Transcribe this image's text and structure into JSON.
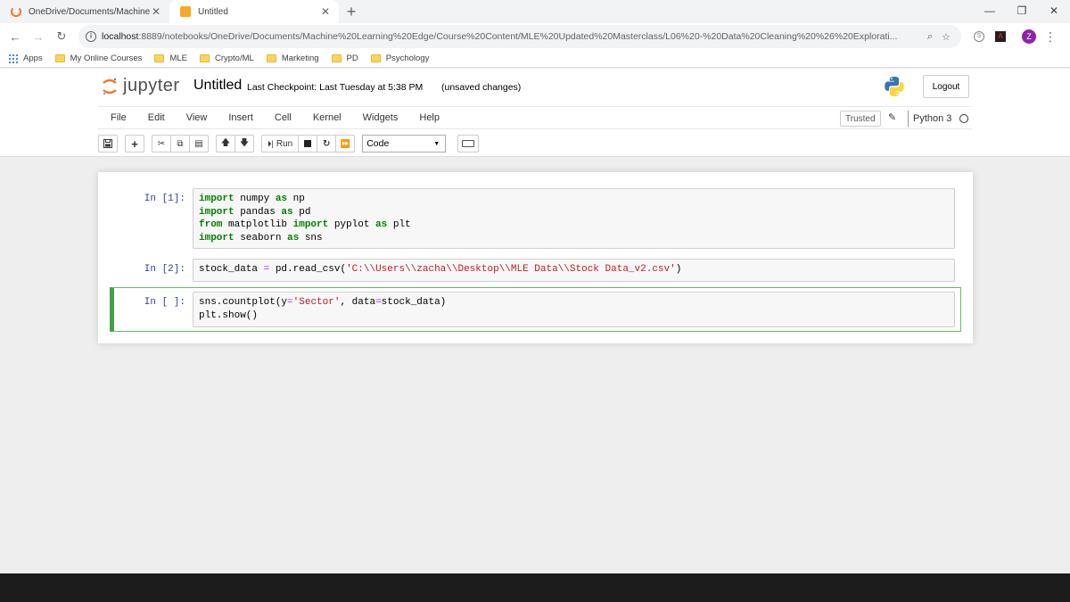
{
  "browser": {
    "tabs": [
      {
        "label": "OneDrive/Documents/Machine L",
        "close": "✕"
      },
      {
        "label": "Untitled",
        "close": "✕"
      }
    ],
    "new_tab": "+",
    "window_controls": {
      "minimize": "—",
      "restore": "❐",
      "close": "✕"
    },
    "url_host": "localhost",
    "url_path": ":8889/notebooks/OneDrive/Documents/Machine%20Learning%20Edge/Course%20Content/MLE%20Updated%20Masterclass/L06%20-%20Data%20Cleaning%20%26%20Explorati...",
    "bookmarks": [
      "Apps",
      "My Online Courses",
      "MLE",
      "Crypto/ML",
      "Marketing",
      "PD",
      "Psychology"
    ],
    "profile_initial": "Z"
  },
  "jupyter": {
    "logo_text": "jupyter",
    "notebook_title": "Untitled",
    "checkpoint": "Last Checkpoint: Last Tuesday at 5:38 PM",
    "unsaved": "(unsaved changes)",
    "logout_label": "Logout",
    "menu": [
      "File",
      "Edit",
      "View",
      "Insert",
      "Cell",
      "Kernel",
      "Widgets",
      "Help"
    ],
    "trusted_label": "Trusted",
    "kernel_name": "Python 3",
    "toolbar": {
      "run_label": "Run",
      "cell_type": "Code"
    }
  },
  "cells": [
    {
      "prompt": "In [1]:",
      "lines": [
        [
          {
            "t": "import",
            "c": "kw"
          },
          {
            "t": " numpy ",
            "c": ""
          },
          {
            "t": "as",
            "c": "kw"
          },
          {
            "t": " np",
            "c": ""
          }
        ],
        [
          {
            "t": "import",
            "c": "kw"
          },
          {
            "t": " pandas ",
            "c": ""
          },
          {
            "t": "as",
            "c": "kw"
          },
          {
            "t": " pd",
            "c": ""
          }
        ],
        [
          {
            "t": "from",
            "c": "kw"
          },
          {
            "t": " matplotlib ",
            "c": ""
          },
          {
            "t": "import",
            "c": "kw"
          },
          {
            "t": " pyplot ",
            "c": ""
          },
          {
            "t": "as",
            "c": "kw"
          },
          {
            "t": " plt",
            "c": ""
          }
        ],
        [
          {
            "t": "import",
            "c": "kw"
          },
          {
            "t": " seaborn ",
            "c": ""
          },
          {
            "t": "as",
            "c": "kw"
          },
          {
            "t": " sns",
            "c": ""
          }
        ]
      ]
    },
    {
      "prompt": "In [2]:",
      "lines": [
        [
          {
            "t": "stock_data ",
            "c": ""
          },
          {
            "t": "=",
            "c": "op"
          },
          {
            "t": " pd.read_csv(",
            "c": ""
          },
          {
            "t": "'C:\\\\Users\\\\zacha\\\\Desktop\\\\MLE Data\\\\Stock Data_v2.csv'",
            "c": "str"
          },
          {
            "t": ")",
            "c": ""
          }
        ]
      ]
    },
    {
      "prompt": "In [ ]:",
      "lines": [
        [
          {
            "t": "sns.countplot(y",
            "c": ""
          },
          {
            "t": "=",
            "c": "op"
          },
          {
            "t": "'Sector'",
            "c": "str"
          },
          {
            "t": ", data",
            "c": ""
          },
          {
            "t": "=",
            "c": "op"
          },
          {
            "t": "stock_data)",
            "c": ""
          }
        ],
        [
          {
            "t": "plt.show()",
            "c": ""
          }
        ]
      ]
    }
  ],
  "colors": {
    "accent_orange": "#f37726",
    "prompt_blue": "#303f9f",
    "selected_green": "#42a047"
  }
}
